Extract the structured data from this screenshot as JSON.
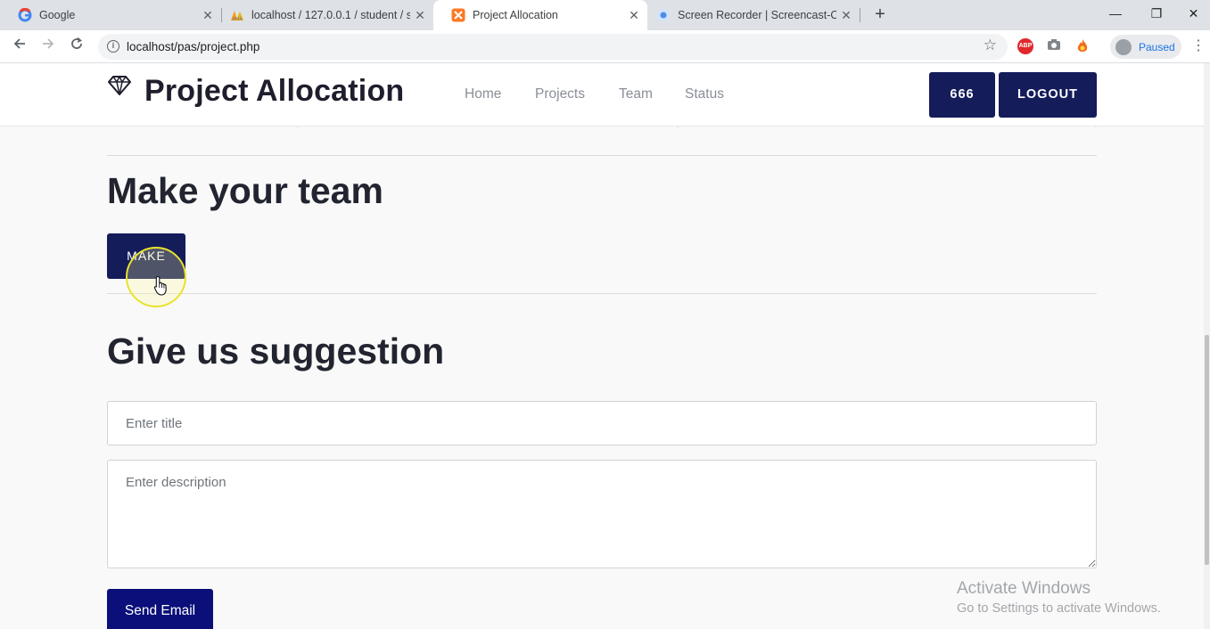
{
  "browser": {
    "tabs": [
      {
        "title": "Google",
        "icon": "google-icon",
        "active": false
      },
      {
        "title": "localhost / 127.0.0.1 / student / s",
        "icon": "phpmyadmin-icon",
        "active": false
      },
      {
        "title": "Project Allocation",
        "icon": "xampp-icon",
        "active": true
      },
      {
        "title": "Screen Recorder | Screencast-O-M",
        "icon": "screencast-icon",
        "active": false
      }
    ],
    "url": "localhost/pas/project.php",
    "profile_label": "Paused",
    "extensions": [
      "adblock-icon",
      "camera-icon",
      "fire-icon"
    ]
  },
  "site": {
    "brand": "Project Allocation",
    "nav": [
      "Home",
      "Projects",
      "Team",
      "Status"
    ],
    "user_id_button": "666",
    "logout_button": "LOGOUT"
  },
  "team_section": {
    "heading": "Make your team",
    "button": "MAKE"
  },
  "suggestion_section": {
    "heading": "Give us suggestion",
    "title_placeholder": "Enter title",
    "description_placeholder": "Enter description",
    "send_button": "Send Email"
  },
  "watermark": {
    "line1": "Activate Windows",
    "line2": "Go to Settings to activate Windows."
  },
  "colors": {
    "button_primary": "#141c5a",
    "send_button": "#0a0f7a",
    "cursor_highlight": "#e8e22d"
  }
}
